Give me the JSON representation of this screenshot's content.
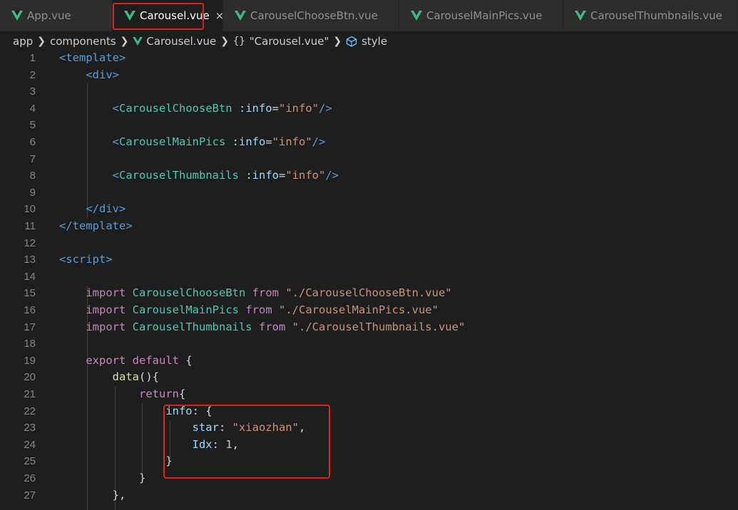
{
  "tabs": [
    {
      "label": "App.vue",
      "active": false
    },
    {
      "label": "Carousel.vue",
      "active": true
    },
    {
      "label": "CarouselChooseBtn.vue",
      "active": false
    },
    {
      "label": "CarouselMainPics.vue",
      "active": false
    },
    {
      "label": "CarouselThumbnails.vue",
      "active": false
    }
  ],
  "close_glyph": "×",
  "breadcrumb": {
    "folder1": "app",
    "folder2": "components",
    "file": "Carousel.vue",
    "braces": "{}",
    "section": "\"Carousel.vue\"",
    "symbol": "style"
  },
  "colors": {
    "vue_green": "#41b883",
    "highlight": "#e02020"
  },
  "code_lines": [
    {
      "n": "1",
      "tokens": [
        [
          "tag",
          "<template>"
        ]
      ]
    },
    {
      "n": "2",
      "tokens": [
        [
          "txt",
          "    "
        ],
        [
          "tag",
          "<div>"
        ]
      ]
    },
    {
      "n": "3",
      "tokens": []
    },
    {
      "n": "4",
      "tokens": [
        [
          "txt",
          "        "
        ],
        [
          "tag",
          "<"
        ],
        [
          "comp",
          "CarouselChooseBtn"
        ],
        [
          "txt",
          " "
        ],
        [
          "attr",
          ":info"
        ],
        [
          "txt",
          "="
        ],
        [
          "str",
          "\"info\""
        ],
        [
          "tag",
          "/>"
        ]
      ]
    },
    {
      "n": "5",
      "tokens": []
    },
    {
      "n": "6",
      "tokens": [
        [
          "txt",
          "        "
        ],
        [
          "tag",
          "<"
        ],
        [
          "comp",
          "CarouselMainPics"
        ],
        [
          "txt",
          " "
        ],
        [
          "attr",
          ":info"
        ],
        [
          "txt",
          "="
        ],
        [
          "str",
          "\"info\""
        ],
        [
          "tag",
          "/>"
        ]
      ]
    },
    {
      "n": "7",
      "tokens": []
    },
    {
      "n": "8",
      "tokens": [
        [
          "txt",
          "        "
        ],
        [
          "tag",
          "<"
        ],
        [
          "comp",
          "CarouselThumbnails"
        ],
        [
          "txt",
          " "
        ],
        [
          "attr",
          ":info"
        ],
        [
          "txt",
          "="
        ],
        [
          "str",
          "\"info\""
        ],
        [
          "tag",
          "/>"
        ]
      ]
    },
    {
      "n": "9",
      "tokens": []
    },
    {
      "n": "10",
      "tokens": [
        [
          "txt",
          "    "
        ],
        [
          "tag",
          "</div>"
        ]
      ]
    },
    {
      "n": "11",
      "tokens": [
        [
          "tag",
          "</template>"
        ]
      ]
    },
    {
      "n": "12",
      "tokens": []
    },
    {
      "n": "13",
      "tokens": [
        [
          "tag",
          "<script>"
        ]
      ]
    },
    {
      "n": "14",
      "tokens": []
    },
    {
      "n": "15",
      "tokens": [
        [
          "txt",
          "    "
        ],
        [
          "kw",
          "import"
        ],
        [
          "txt",
          " "
        ],
        [
          "comp",
          "CarouselChooseBtn"
        ],
        [
          "txt",
          " "
        ],
        [
          "kw",
          "from"
        ],
        [
          "txt",
          " "
        ],
        [
          "str",
          "\"./CarouselChooseBtn.vue\""
        ]
      ]
    },
    {
      "n": "16",
      "tokens": [
        [
          "txt",
          "    "
        ],
        [
          "kw",
          "import"
        ],
        [
          "txt",
          " "
        ],
        [
          "comp",
          "CarouselMainPics"
        ],
        [
          "txt",
          " "
        ],
        [
          "kw",
          "from"
        ],
        [
          "txt",
          " "
        ],
        [
          "str",
          "\"./CarouselMainPics.vue\""
        ]
      ]
    },
    {
      "n": "17",
      "tokens": [
        [
          "txt",
          "    "
        ],
        [
          "kw",
          "import"
        ],
        [
          "txt",
          " "
        ],
        [
          "comp",
          "CarouselThumbnails"
        ],
        [
          "txt",
          " "
        ],
        [
          "kw",
          "from"
        ],
        [
          "txt",
          " "
        ],
        [
          "str",
          "\"./CarouselThumbnails.vue\""
        ]
      ]
    },
    {
      "n": "18",
      "tokens": []
    },
    {
      "n": "19",
      "tokens": [
        [
          "txt",
          "    "
        ],
        [
          "kw",
          "export"
        ],
        [
          "txt",
          " "
        ],
        [
          "kw",
          "default"
        ],
        [
          "txt",
          " {"
        ]
      ]
    },
    {
      "n": "20",
      "tokens": [
        [
          "txt",
          "        "
        ],
        [
          "fn",
          "data"
        ],
        [
          "txt",
          "(){"
        ]
      ]
    },
    {
      "n": "21",
      "tokens": [
        [
          "txt",
          "            "
        ],
        [
          "kw",
          "return"
        ],
        [
          "txt",
          "{"
        ]
      ]
    },
    {
      "n": "22",
      "tokens": [
        [
          "txt",
          "                "
        ],
        [
          "attr",
          "info"
        ],
        [
          "txt",
          ": {"
        ]
      ]
    },
    {
      "n": "23",
      "tokens": [
        [
          "txt",
          "                    "
        ],
        [
          "attr",
          "star"
        ],
        [
          "txt",
          ": "
        ],
        [
          "str",
          "\"xiaozhan\""
        ],
        [
          "txt",
          ","
        ]
      ]
    },
    {
      "n": "24",
      "tokens": [
        [
          "txt",
          "                    "
        ],
        [
          "attr",
          "Idx"
        ],
        [
          "txt",
          ": "
        ],
        [
          "num",
          "1"
        ],
        [
          "txt",
          ","
        ]
      ]
    },
    {
      "n": "25",
      "tokens": [
        [
          "txt",
          "                "
        ],
        [
          "txt",
          "}"
        ]
      ]
    },
    {
      "n": "26",
      "tokens": [
        [
          "txt",
          "            "
        ],
        [
          "txt",
          "}"
        ]
      ]
    },
    {
      "n": "27",
      "tokens": [
        [
          "txt",
          "        "
        ],
        [
          "txt",
          "},"
        ]
      ]
    }
  ]
}
